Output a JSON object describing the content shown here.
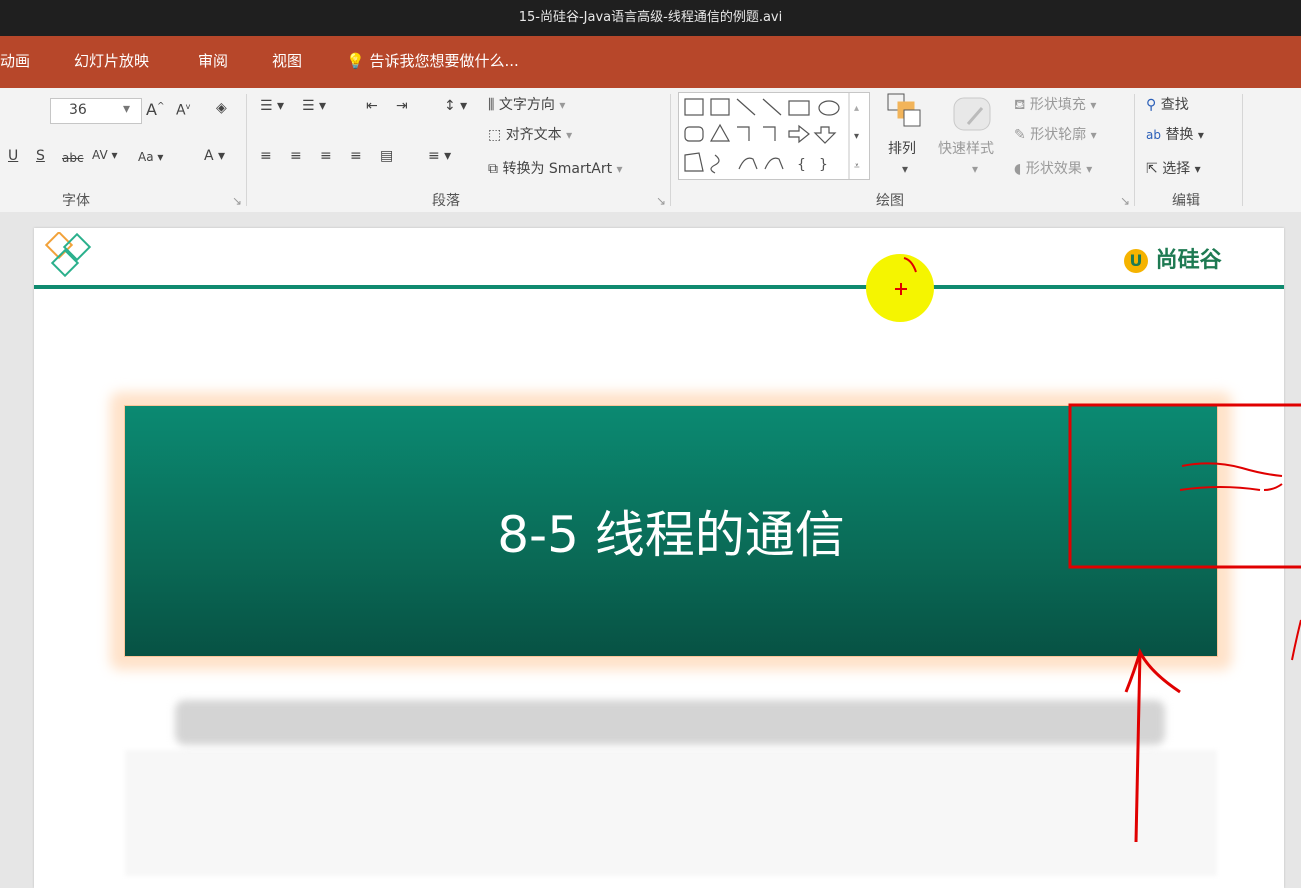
{
  "window": {
    "title": "15-尚硅谷-Java语言高级-线程通信的例题.avi"
  },
  "menu": {
    "items": [
      "动画",
      "幻灯片放映",
      "审阅",
      "视图",
      "告诉我您想要做什么..."
    ]
  },
  "ribbon": {
    "font": {
      "size_value": "36",
      "group_label": "字体"
    },
    "paragraph": {
      "group_label": "段落",
      "text_direction": "文字方向",
      "align_text": "对齐文本",
      "convert_smartart": "转换为 SmartArt"
    },
    "drawing": {
      "group_label": "绘图",
      "arrange": "排列",
      "quick_styles": "快速样式",
      "shape_fill": "形状填充",
      "shape_outline": "形状轮廓",
      "shape_effects": "形状效果"
    },
    "editing": {
      "group_label": "编辑",
      "find": "查找",
      "replace": "替换",
      "select": "选择"
    }
  },
  "slide": {
    "brand": "尚硅谷",
    "title": "8-5 线程的通信"
  },
  "colors": {
    "menu_bar": "#b7472a",
    "banner": "#0a7a63",
    "annotation": "#e00000",
    "cursor_highlight": "#f5f500"
  }
}
